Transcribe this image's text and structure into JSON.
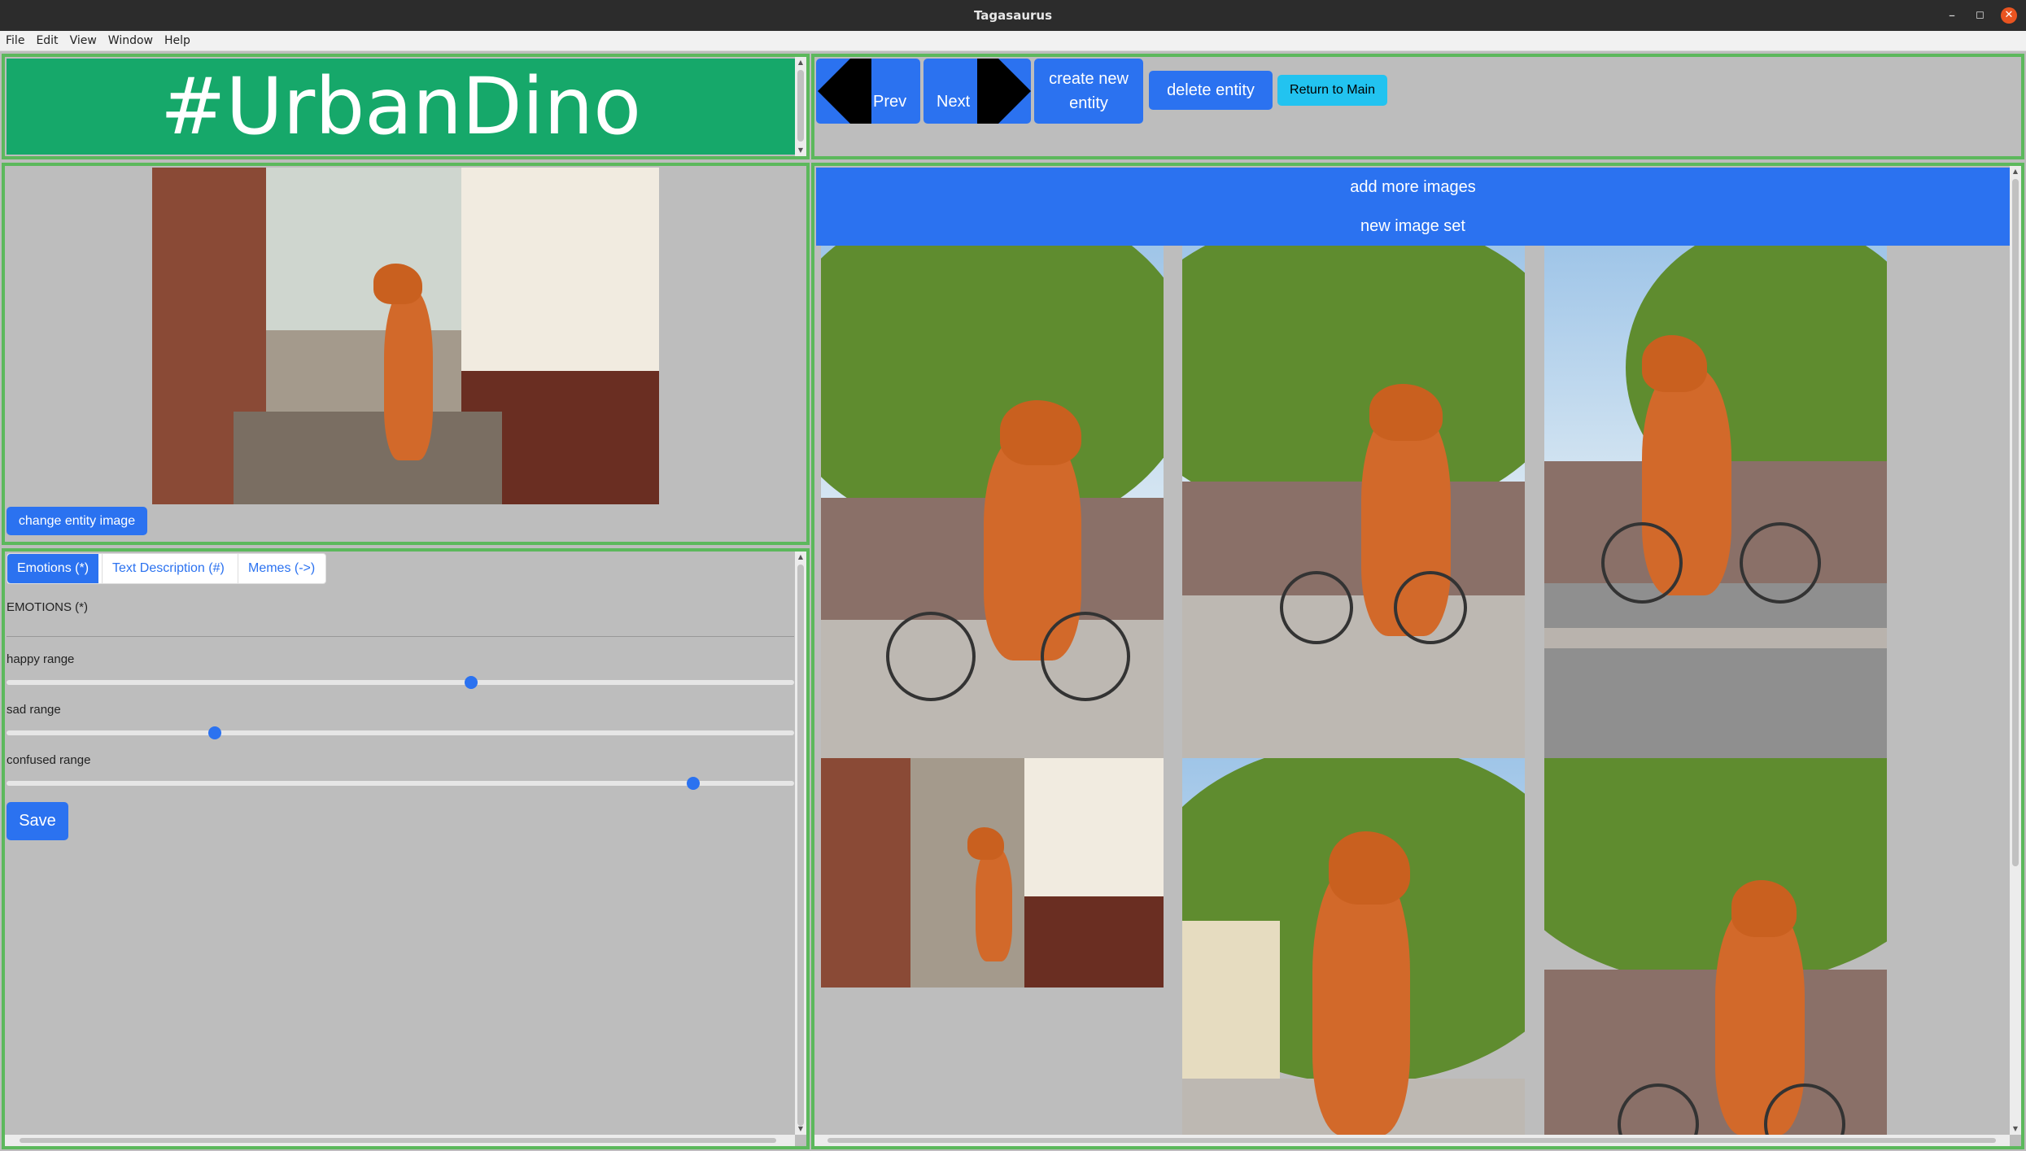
{
  "window": {
    "title": "Tagasaurus",
    "minimize_glyph": "–",
    "maximize_glyph": "◻",
    "close_glyph": "✕"
  },
  "menu": [
    "File",
    "Edit",
    "View",
    "Window",
    "Help"
  ],
  "entity": {
    "name": "#UrbanDino",
    "accent": "#16a86a"
  },
  "nav": {
    "prev_label": "Prev",
    "next_label": "Next",
    "create_label_1": "create new",
    "create_label_2": "entity",
    "delete_label": "delete entity",
    "return_label": "Return to Main"
  },
  "entity_image": {
    "change_label": "change entity image"
  },
  "tabs": [
    {
      "label": "Emotions (*)",
      "active": true
    },
    {
      "label": "Text Description (#)",
      "active": false
    },
    {
      "label": "Memes (->)",
      "active": false
    }
  ],
  "emotions": {
    "heading": "EMOTIONS (*)",
    "sliders": [
      {
        "label": "happy range",
        "value": 0.59
      },
      {
        "label": "sad range",
        "value": 0.264
      },
      {
        "label": "confused range",
        "value": 0.872
      }
    ],
    "save_label": "Save"
  },
  "gallery": {
    "add_label": "add more images",
    "new_set_label": "new image set"
  },
  "colors": {
    "primary": "#2b72f0",
    "panel_border": "#5cb85c",
    "return_button": "#22c3f0",
    "background": "#bdbdbd"
  }
}
